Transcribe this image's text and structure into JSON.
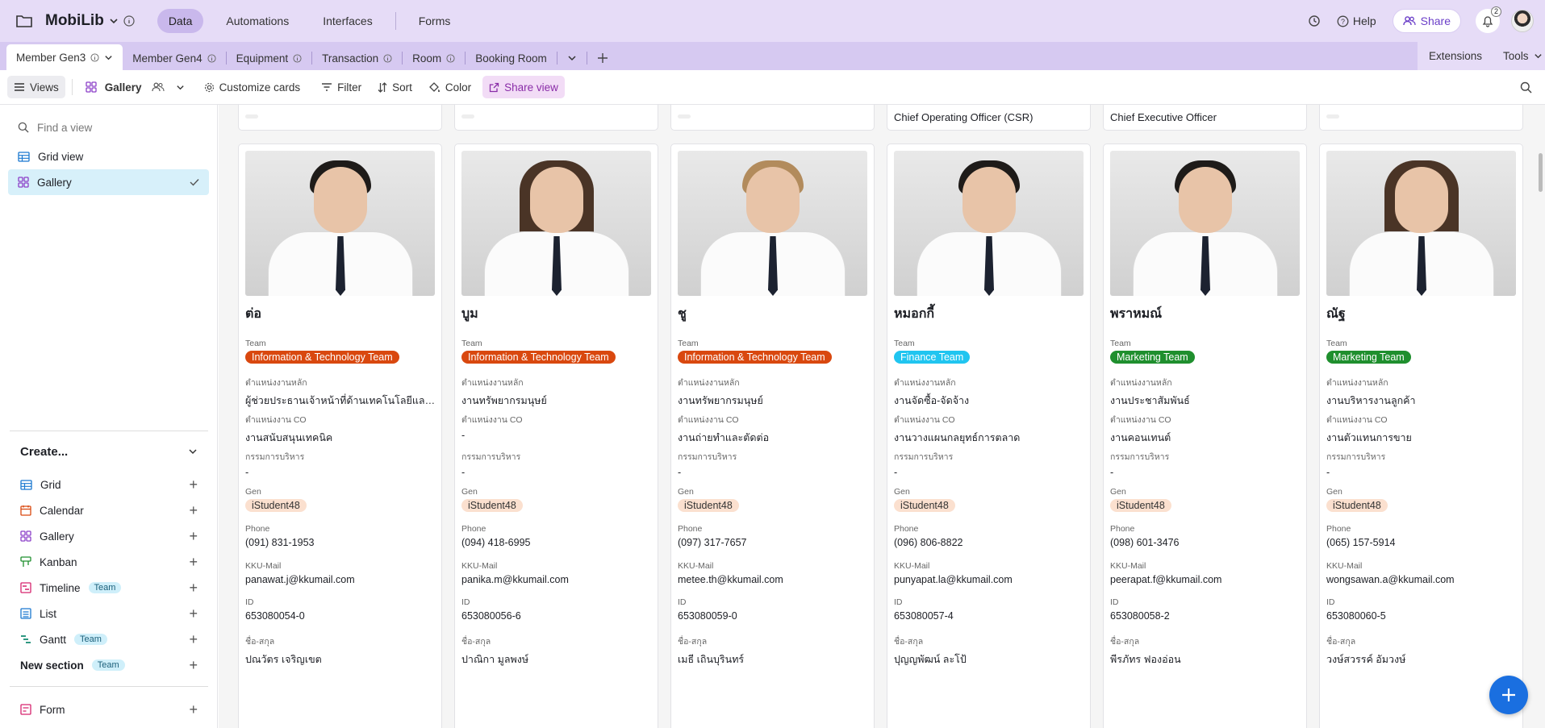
{
  "app": {
    "base_name": "MobiLib",
    "nav": [
      "Data",
      "Automations",
      "Interfaces",
      "Forms"
    ],
    "help_label": "Help",
    "share_label": "Share",
    "notification_count": "2"
  },
  "tabs": {
    "items": [
      "Member Gen3",
      "Member Gen4",
      "Equipment",
      "Transaction",
      "Room",
      "Booking Room"
    ],
    "extensions_label": "Extensions",
    "tools_label": "Tools"
  },
  "viewbar": {
    "views_label": "Views",
    "view_name": "Gallery",
    "customize_label": "Customize cards",
    "filter_label": "Filter",
    "sort_label": "Sort",
    "color_label": "Color",
    "share_view_label": "Share view"
  },
  "sidebar": {
    "find_placeholder": "Find a view",
    "views": [
      "Grid view",
      "Gallery"
    ],
    "create_label": "Create...",
    "create_items": [
      {
        "label": "Grid",
        "badge": ""
      },
      {
        "label": "Calendar",
        "badge": ""
      },
      {
        "label": "Gallery",
        "badge": ""
      },
      {
        "label": "Kanban",
        "badge": ""
      },
      {
        "label": "Timeline",
        "badge": "Team"
      },
      {
        "label": "List",
        "badge": ""
      },
      {
        "label": "Gantt",
        "badge": "Team"
      },
      {
        "label": "New section",
        "badge": "Team"
      }
    ],
    "form_label": "Form"
  },
  "colors": {
    "it_team": "#d9480f",
    "finance_team": "#20c5f0",
    "marketing_team": "#1f8f2e",
    "accent": "#6b3fc8"
  },
  "gallery": {
    "top_row": [
      "",
      "",
      "",
      "Chief Operating Officer (CSR)",
      "Chief Executive Officer",
      ""
    ],
    "labels": {
      "team": "Team",
      "position_main": "ตำแหน่งงานหลัก",
      "position_co": "ตำแหน่งงาน CO",
      "committee": "กรรมการบริหาร",
      "gen": "Gen",
      "phone": "Phone",
      "mail": "KKU-Mail",
      "id": "ID",
      "fullname": "ชื่อ-สกุล"
    },
    "cards": [
      {
        "name": "ต่อ",
        "team": "Information & Technology Team",
        "team_color": "it_team",
        "position_main": "ผู้ช่วยประธานเจ้าหน้าที่ด้านเทคโนโลยีและสารสนเทศ",
        "position_co": "งานสนับสนุนเทคนิค",
        "committee": "-",
        "gen": "iStudent48",
        "phone": "(091) 831-1953",
        "mail": "panawat.j@kkumail.com",
        "id": "653080054-0",
        "fullname": "ปณวัตร เจริญเขต"
      },
      {
        "name": "บูม",
        "team": "Information & Technology Team",
        "team_color": "it_team",
        "position_main": "งานทรัพยากรมนุษย์",
        "position_co": "-",
        "committee": "-",
        "gen": "iStudent48",
        "phone": "(094) 418-6995",
        "mail": "panika.m@kkumail.com",
        "id": "653080056-6",
        "fullname": "ปาณิกา มูลพงษ์"
      },
      {
        "name": "ชู",
        "team": "Information & Technology Team",
        "team_color": "it_team",
        "position_main": "งานทรัพยากรมนุษย์",
        "position_co": "งานถ่ายทำและตัดต่อ",
        "committee": "-",
        "gen": "iStudent48",
        "phone": "(097) 317-7657",
        "mail": "metee.th@kkumail.com",
        "id": "653080059-0",
        "fullname": "เมธี เถินบุรินทร์"
      },
      {
        "name": "หมอกกี้",
        "team": "Finance Team",
        "team_color": "finance_team",
        "position_main": "งานจัดซื้อ-จัดจ้าง",
        "position_co": "งานวางแผนกลยุทธ์การตลาด",
        "committee": "-",
        "gen": "iStudent48",
        "phone": "(096) 806-8822",
        "mail": "punyapat.la@kkumail.com",
        "id": "653080057-4",
        "fullname": "ปุญญพัฒน์ ละโป้"
      },
      {
        "name": "พราหมณ์",
        "team": "Marketing Team",
        "team_color": "marketing_team",
        "position_main": "งานประชาสัมพันธ์",
        "position_co": "งานคอนเทนต์",
        "committee": "-",
        "gen": "iStudent48",
        "phone": "(098) 601-3476",
        "mail": "peerapat.f@kkumail.com",
        "id": "653080058-2",
        "fullname": "พีรภัทร ฟองอ่อน"
      },
      {
        "name": "ณัฐ",
        "team": "Marketing Team",
        "team_color": "marketing_team",
        "position_main": "งานบริหารงานลูกค้า",
        "position_co": "งานตัวแทนการขาย",
        "committee": "-",
        "gen": "iStudent48",
        "phone": "(065) 157-5914",
        "mail": "wongsawan.a@kkumail.com",
        "id": "653080060-5",
        "fullname": "วงษ์สวรรค์ อัมวงษ์"
      }
    ]
  }
}
